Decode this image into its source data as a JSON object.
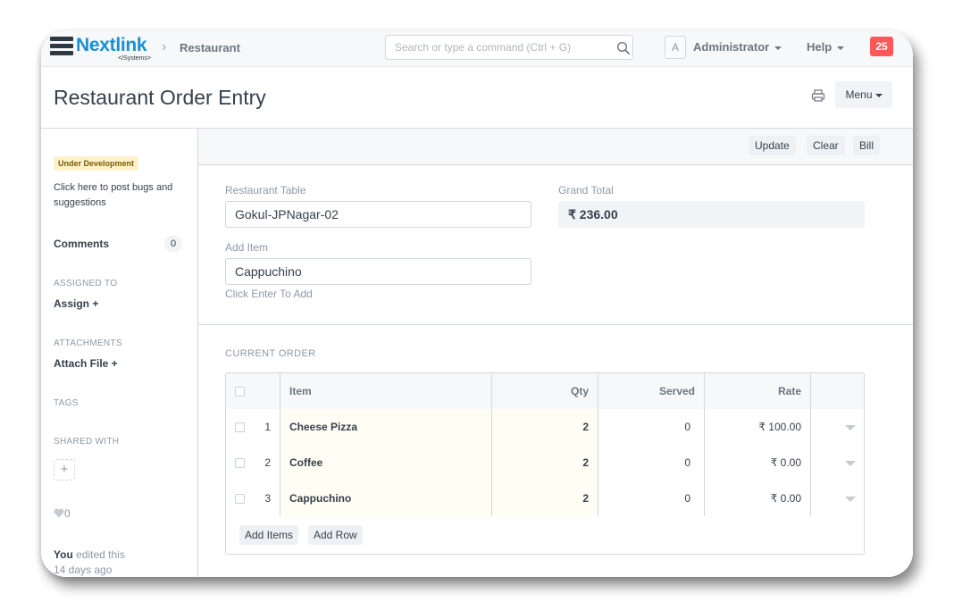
{
  "navbar": {
    "logo_text": "Nextlink",
    "logo_sub": "</Systems>",
    "breadcrumb": "Restaurant",
    "search_placeholder": "Search or type a command (Ctrl + G)",
    "avatar_letter": "A",
    "user_name": "Administrator",
    "help_label": "Help",
    "notification_count": "25"
  },
  "page": {
    "title": "Restaurant Order Entry",
    "menu_label": "Menu"
  },
  "sidebar": {
    "dev_badge": "Under Development",
    "dev_link": "Click here to post bugs and suggestions",
    "comments_label": "Comments",
    "comments_count": "0",
    "assigned_caption": "ASSIGNED TO",
    "assign_label": "Assign +",
    "attachments_caption": "ATTACHMENTS",
    "attach_label": "Attach File +",
    "tags_caption": "TAGS",
    "shared_caption": "SHARED WITH",
    "share_add": "+",
    "likes": "0",
    "edited_user": "You",
    "edited_text": " edited this",
    "edited_when": "14 days ago"
  },
  "toolbar": {
    "update_label": "Update",
    "clear_label": "Clear",
    "bill_label": "Bill"
  },
  "form": {
    "table_label": "Restaurant Table",
    "table_value": "Gokul-JPNagar-02",
    "grand_total_label": "Grand Total",
    "grand_total_value": "₹ 236.00",
    "add_item_label": "Add Item",
    "add_item_value": "Cappuchino",
    "add_item_hint": "Click Enter To Add"
  },
  "order": {
    "section_title": "CURRENT ORDER",
    "headers": {
      "item": "Item",
      "qty": "Qty",
      "served": "Served",
      "rate": "Rate"
    },
    "rows": [
      {
        "idx": "1",
        "item": "Cheese Pizza",
        "qty": "2",
        "served": "0",
        "rate": "₹ 100.00"
      },
      {
        "idx": "2",
        "item": "Coffee",
        "qty": "2",
        "served": "0",
        "rate": "₹ 0.00"
      },
      {
        "idx": "3",
        "item": "Cappuchino",
        "qty": "2",
        "served": "0",
        "rate": "₹ 0.00"
      }
    ],
    "add_items_label": "Add Items",
    "add_row_label": "Add Row"
  },
  "icons": {
    "search": "search-icon",
    "print": "print-icon",
    "heart": "heart-icon",
    "chevron": "chevron-right-icon"
  },
  "colors": {
    "brand": "#1a8fd6",
    "notification": "#ff5858",
    "dev_badge_bg": "#fff1cc",
    "editable_cell_bg": "#fffdf4"
  }
}
